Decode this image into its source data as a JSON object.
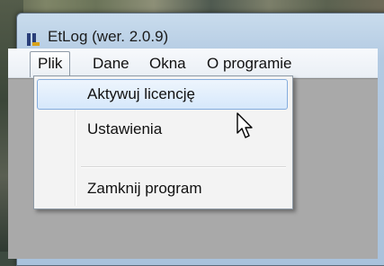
{
  "window": {
    "title": "EtLog (wer. 2.0.9)",
    "icon": "etlog-app-icon"
  },
  "menubar": {
    "items": [
      {
        "label": "Plik",
        "active": true
      },
      {
        "label": "Dane"
      },
      {
        "label": "Okna"
      },
      {
        "label": "O programie"
      }
    ]
  },
  "dropdown": {
    "items": [
      {
        "label": "Aktywuj licencję",
        "highlighted": true
      },
      {
        "label": "Ustawienia"
      },
      {
        "label": "Zamknij program"
      }
    ]
  },
  "cursor": "arrow-pointer-icon",
  "colors": {
    "highlight_border": "#84acdd",
    "highlight_fill": "#d6e8fb",
    "menu_bg": "#f3f3f3",
    "client_bg": "#a9a9a9"
  }
}
